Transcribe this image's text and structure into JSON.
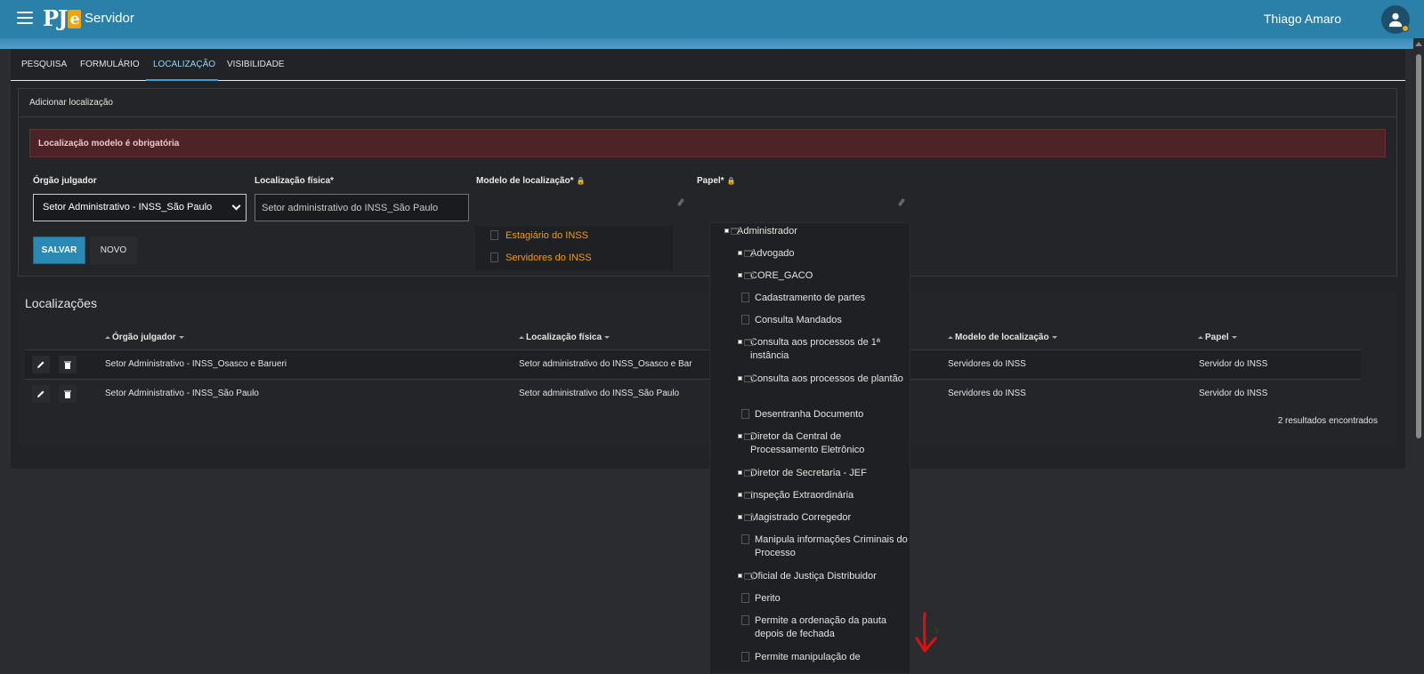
{
  "header": {
    "logo_text": "PJ",
    "logo_accent": "e",
    "title": "Servidor",
    "user_name": "Thiago Amaro"
  },
  "tabs": [
    {
      "label": "PESQUISA",
      "active": false
    },
    {
      "label": "FORMULÁRIO",
      "active": false
    },
    {
      "label": "LOCALIZAÇÃO",
      "active": true
    },
    {
      "label": "VISIBILIDADE",
      "active": false
    }
  ],
  "form": {
    "section_title": "Adicionar localização",
    "alert": "Localização modelo é obrigatória",
    "orgao_label": "Órgão julgador",
    "orgao_value": "Setor Administrativo - INSS_São Paulo",
    "localizacao_label": "Localização física*",
    "localizacao_value": "Setor administrativo do INSS_São Paulo",
    "modelo_label": "Modelo de localização*",
    "papel_label": "Papel*",
    "save_label": "SALVAR",
    "new_label": "NOVO",
    "modelo_options": [
      "Estagiário do INSS",
      "Servidores do INSS"
    ]
  },
  "results": {
    "title": "Localizações",
    "columns": [
      "Órgão julgador",
      "Localização física",
      "Modelo de localização",
      "Papel"
    ],
    "rows": [
      {
        "orgao": "Setor Administrativo - INSS_Osasco e Barueri",
        "localizacao": "Setor administrativo do INSS_Osasco e Bar",
        "modelo": "Servidores do INSS",
        "papel": "Servidor do INSS"
      },
      {
        "orgao": "Setor Administrativo - INSS_São Paulo",
        "localizacao": "Setor administrativo do INSS_São Paulo",
        "modelo": "Servidores do INSS",
        "papel": "Servidor do INSS"
      }
    ],
    "count": "2 resultados encontrados"
  },
  "papel_tree": [
    {
      "label": "Administrador",
      "type": "folder",
      "level": 0
    },
    {
      "label": "Advogado",
      "type": "folder",
      "level": 1
    },
    {
      "label": "CORE_GACO",
      "type": "folder",
      "level": 1
    },
    {
      "label": "Cadastramento de partes",
      "type": "leaf",
      "level": 2
    },
    {
      "label": "Consulta Mandados",
      "type": "leaf",
      "level": 2
    },
    {
      "label": "Consulta aos processos de 1ª instância",
      "type": "folder",
      "level": 1
    },
    {
      "label": "Consulta aos processos de plantão",
      "type": "folder",
      "level": 1
    },
    {
      "label": "Desentranha Documento",
      "type": "leaf",
      "level": 2
    },
    {
      "label": "Diretor da Central de Processamento Eletrônico",
      "type": "folder",
      "level": 1
    },
    {
      "label": "Diretor de Secretaria - JEF",
      "type": "folder",
      "level": 1
    },
    {
      "label": "Inspeção Extraordinária",
      "type": "folder",
      "level": 1
    },
    {
      "label": "Magistrado Corregedor",
      "type": "folder",
      "level": 1
    },
    {
      "label": "Manipula informações Criminais do Processo",
      "type": "leaf",
      "level": 2
    },
    {
      "label": "Oficial de Justiça Distribuidor",
      "type": "folder",
      "level": 1
    },
    {
      "label": "Perito",
      "type": "leaf",
      "level": 2
    },
    {
      "label": "Permite a ordenação da pauta depois de fechada",
      "type": "leaf",
      "level": 2
    },
    {
      "label": "Permite manipulação de",
      "type": "leaf",
      "level": 2
    }
  ],
  "colors": {
    "header": "#2a80a8",
    "accent": "#3a9fd6",
    "alert_bg": "#4e2327",
    "option_link": "#f39c00",
    "annotation_arrow": "#e01010"
  }
}
